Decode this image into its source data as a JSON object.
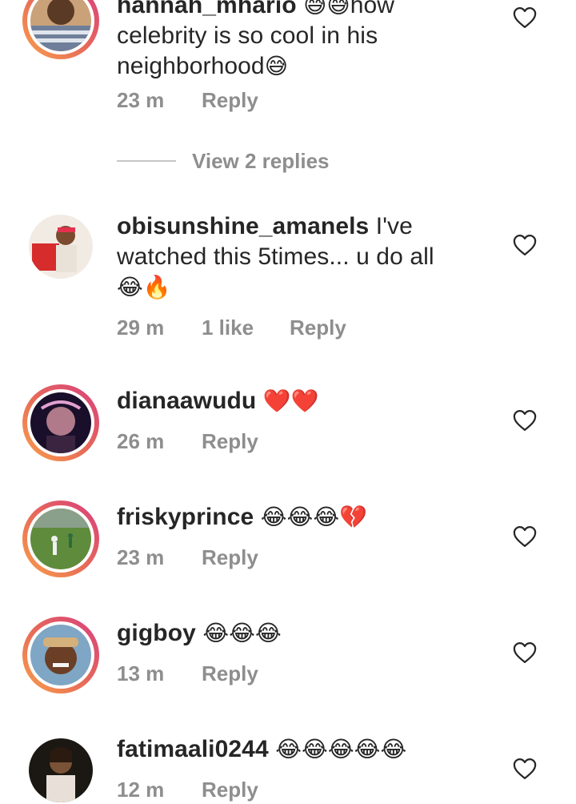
{
  "comments": [
    {
      "username": "hannah_mhario",
      "text": "how celebrity is so cool in his neighborhood",
      "emoji_inline": "😅😅",
      "emoji_end": "😅",
      "time": "23 m",
      "likes": "",
      "reply_label": "Reply",
      "has_story_ring": true
    },
    {
      "username": "obisunshine_amanels",
      "text": "I've watched this 5times... u do all",
      "emoji_end": "😂🔥",
      "time": "29 m",
      "likes": "1 like",
      "reply_label": "Reply",
      "has_story_ring": false
    },
    {
      "username": "dianaawudu",
      "text": "",
      "emoji_end": "❤️❤️",
      "time": "26 m",
      "likes": "",
      "reply_label": "Reply",
      "has_story_ring": true
    },
    {
      "username": "friskyprince",
      "text": "",
      "emoji_end": "😂😂😂💔",
      "time": "23 m",
      "likes": "",
      "reply_label": "Reply",
      "has_story_ring": true
    },
    {
      "username": "gigboy",
      "text": "",
      "emoji_end": "😂😂😂",
      "time": "13 m",
      "likes": "",
      "reply_label": "Reply",
      "has_story_ring": true
    },
    {
      "username": "fatimaali0244",
      "text": "",
      "emoji_end": "😂😂😂😂😂",
      "time": "12 m",
      "likes": "",
      "reply_label": "Reply",
      "has_story_ring": false
    }
  ],
  "view_replies": "View 2 replies",
  "icons": {
    "like": "heart-outline-icon"
  },
  "colors": {
    "text": "#262626",
    "meta": "#8e8e8e",
    "heart_stroke": "#262626",
    "story_ring_start": "#f9a04a",
    "story_ring_end": "#d83f7e"
  }
}
